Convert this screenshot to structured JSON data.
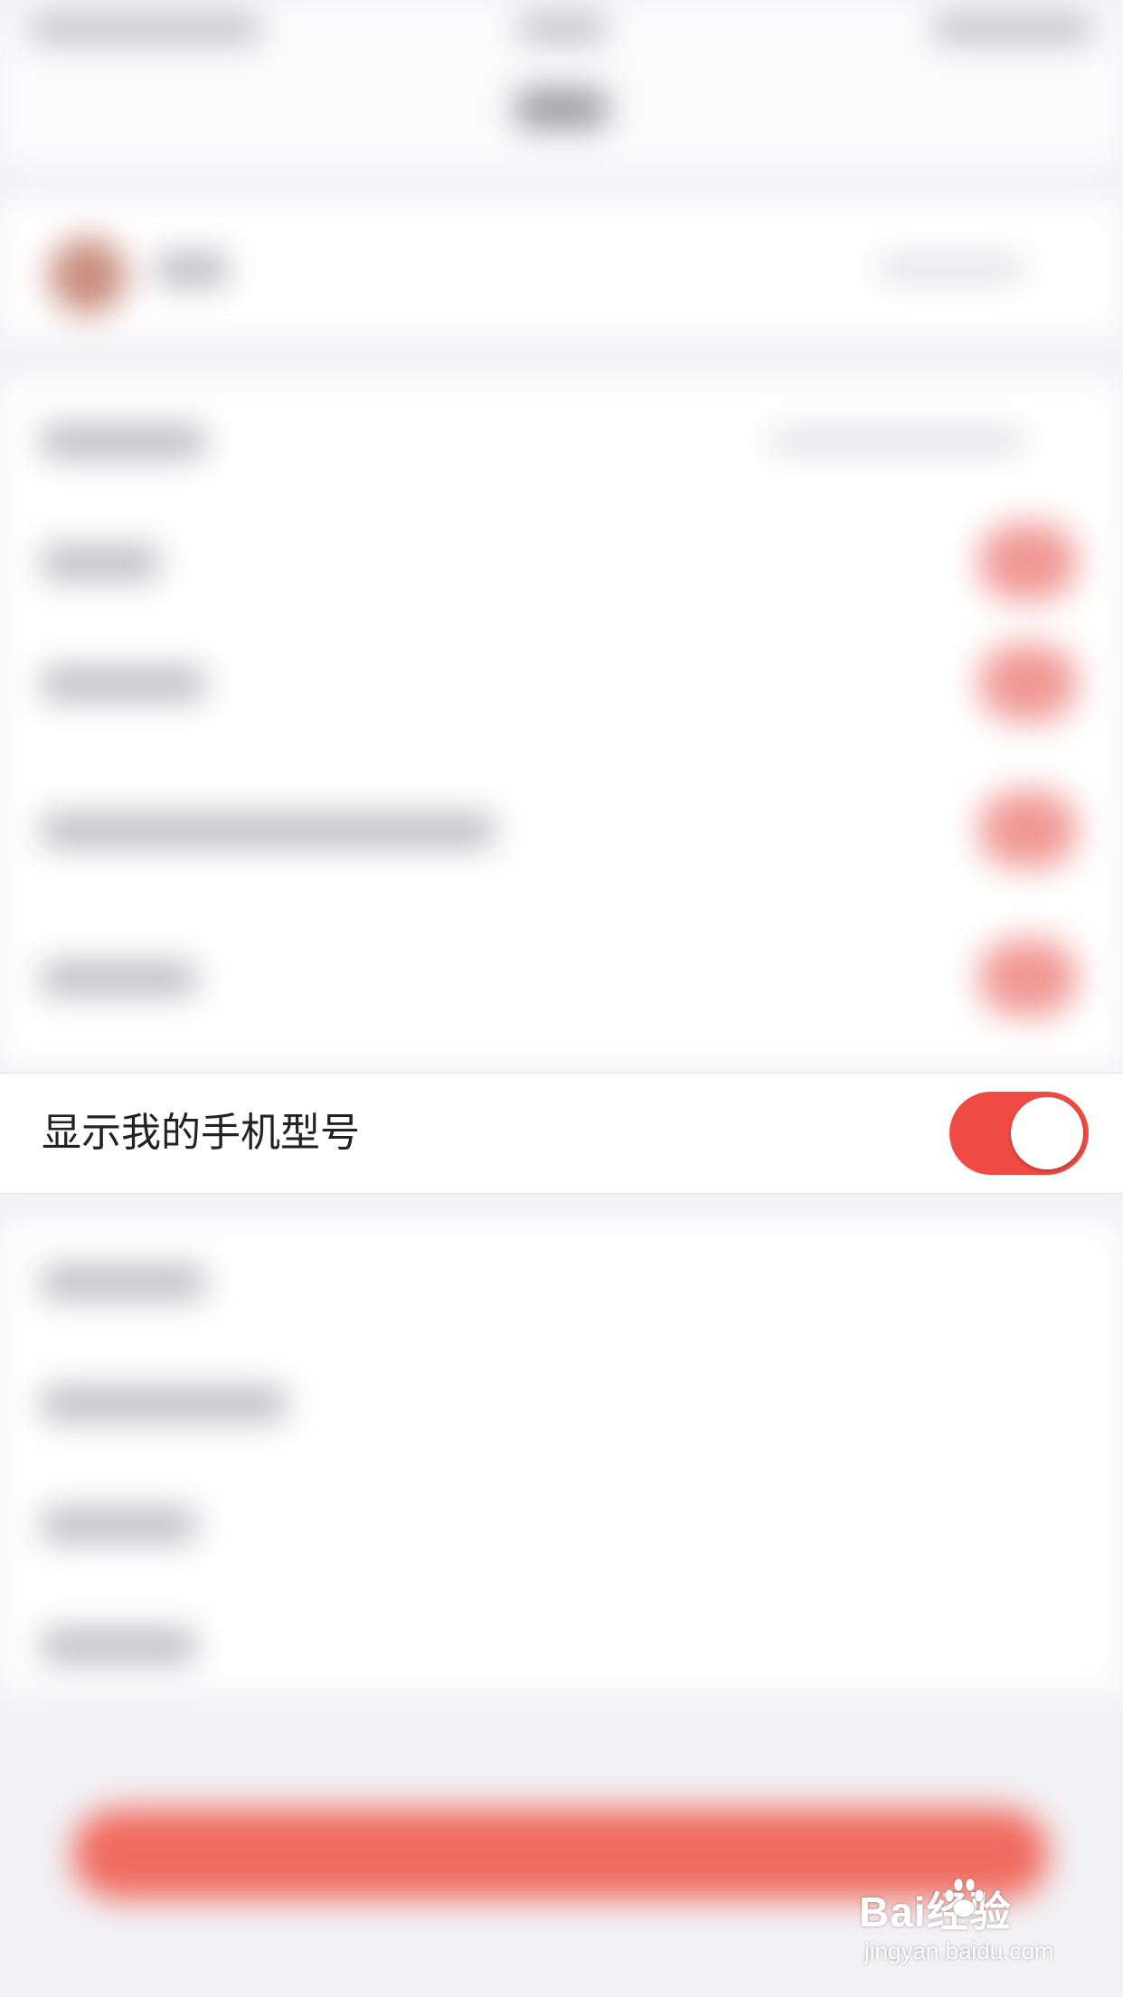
{
  "settings_row": {
    "label": "显示我的手机型号",
    "toggle_on": true
  },
  "colors": {
    "accent": "#ef4a44",
    "row_bg": "#ffffff",
    "page_bg": "#f2f2f5"
  },
  "watermark": {
    "brand": "Bai经验",
    "site": "jingyan.baidu.com"
  }
}
